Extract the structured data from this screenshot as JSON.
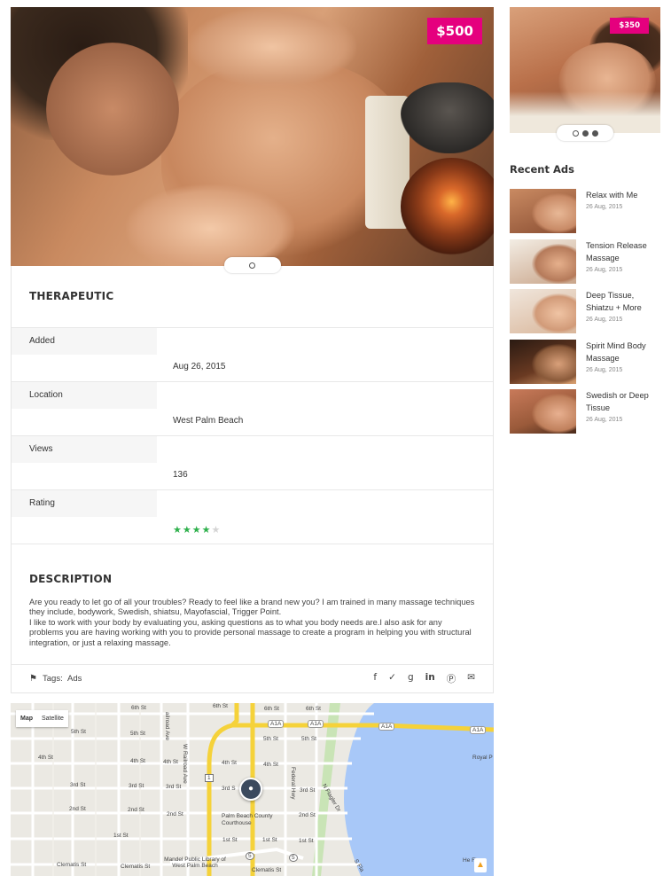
{
  "listing": {
    "price": "$500",
    "title": "THERAPEUTIC",
    "details": [
      {
        "label": "Added",
        "value": "Aug 26, 2015"
      },
      {
        "label": "Location",
        "value": "West Palm Beach"
      },
      {
        "label": "Views",
        "value": "136"
      },
      {
        "label": "Rating",
        "value": ""
      }
    ],
    "rating": {
      "value": 4,
      "max": 5
    },
    "description": {
      "title": "DESCRIPTION",
      "paragraph1": "Are you ready to let go of all your troubles? Ready to feel like a brand new you? I am trained in many massage techniques they include, bodywork, Swedish, shiatsu, Mayofascial, Trigger Point.",
      "paragraph2": "I like to work with your body by evaluating you, asking questions as to what you body needs are.I also ask for any problems you are having working with you to provide personal massage to create a program in helping you with structural integration, or just a relaxing massage."
    },
    "tags": {
      "label": "Tags:",
      "value": "Ads"
    },
    "share_icons": [
      "facebook-icon",
      "twitter-icon",
      "google-plus-icon",
      "linkedin-icon",
      "pinterest-icon",
      "email-icon"
    ]
  },
  "map": {
    "toggle": {
      "map": "Map",
      "satellite": "Satellite"
    },
    "labels": {
      "sixth_a": "6th St",
      "sixth_b": "6th St",
      "sixth_c": "6th St",
      "sixth_d": "6th St",
      "fifth_a": "5th St",
      "fifth_b": "5th St",
      "fifth_c": "5th St",
      "fifth_d": "5th St",
      "fourth_a": "4th St",
      "fourth_b": "4th St",
      "fourth_c": "4th St",
      "fourth_d": "4th St",
      "fourth_e": "4th St",
      "third_a": "3rd St",
      "third_b": "3rd St",
      "third_c": "3rd St",
      "third_d": "3rd S",
      "third_e": "3rd St",
      "second_a": "2nd St",
      "second_b": "2nd St",
      "second_c": "2nd St",
      "second_d": "2nd St",
      "first_a": "1st St",
      "first_b": "1st St",
      "first_c": "1st St",
      "first_d": "1st St",
      "clematis_a": "Clematis St",
      "clematis_b": "Clematis St",
      "clematis_c": "Clematis St",
      "railroad": "ailroad Ave",
      "w_railroad": "W Railroad Ave",
      "federal": "Federal Hwy",
      "flagler": "N Flagler Dr",
      "s_fla": "S Fla",
      "a1a_1": "A1A",
      "a1a_2": "A1A",
      "a1a_3": "A1A",
      "a1a_4": "A1A",
      "route1": "1",
      "route5a": "5",
      "route5b": "5",
      "courthouse": "Palm Beach County Courthouse",
      "library": "Mandel Public Library of West Palm Beach",
      "royal": "Royal P",
      "heritage": "He  Fla"
    }
  },
  "sidebar": {
    "featured_price": "$350",
    "recent_title": "Recent Ads",
    "recent": [
      {
        "name": "Relax with Me",
        "date": "26 Aug, 2015"
      },
      {
        "name": "Tension Release Massage",
        "date": "26 Aug, 2015"
      },
      {
        "name": "Deep Tissue, Shiatzu + More",
        "date": "26 Aug, 2015"
      },
      {
        "name": "Spirit Mind Body Massage",
        "date": "26 Aug, 2015"
      },
      {
        "name": "Swedish or Deep Tissue",
        "date": "26 Aug, 2015"
      }
    ]
  },
  "colors": {
    "accent": "#e5007e",
    "star": "#2db04b",
    "water": "#a8c8f8",
    "highway": "#f5d23a"
  }
}
